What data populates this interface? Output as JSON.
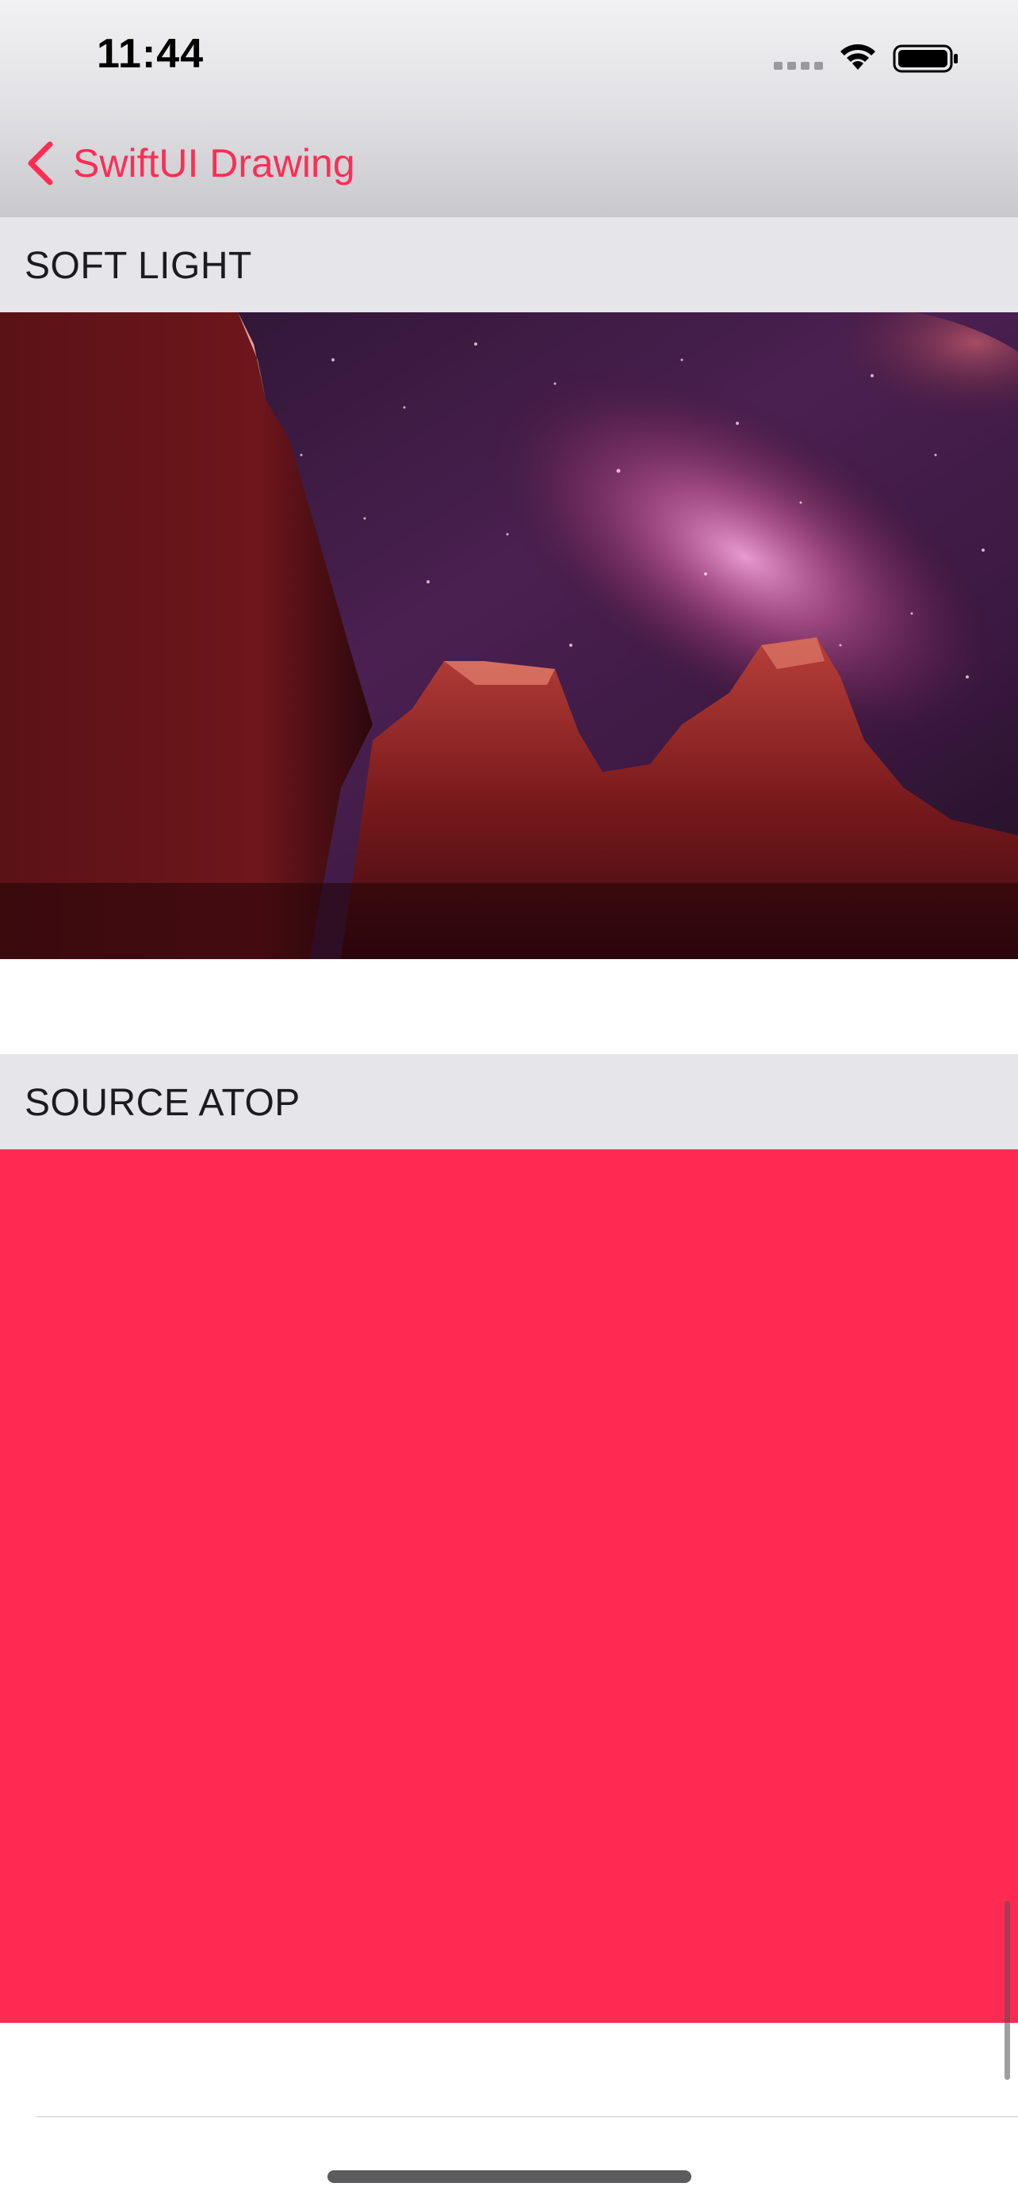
{
  "status_bar": {
    "time": "11:44"
  },
  "navigation": {
    "back_label": "SwiftUI Drawing",
    "accent_color": "#ff2d55"
  },
  "sections": [
    {
      "title": "SOFT LIGHT"
    },
    {
      "title": "SOURCE ATOP"
    }
  ],
  "colors": {
    "section_header_bg": "#e5e5ea",
    "blend_result_red": "#ff2a52"
  }
}
